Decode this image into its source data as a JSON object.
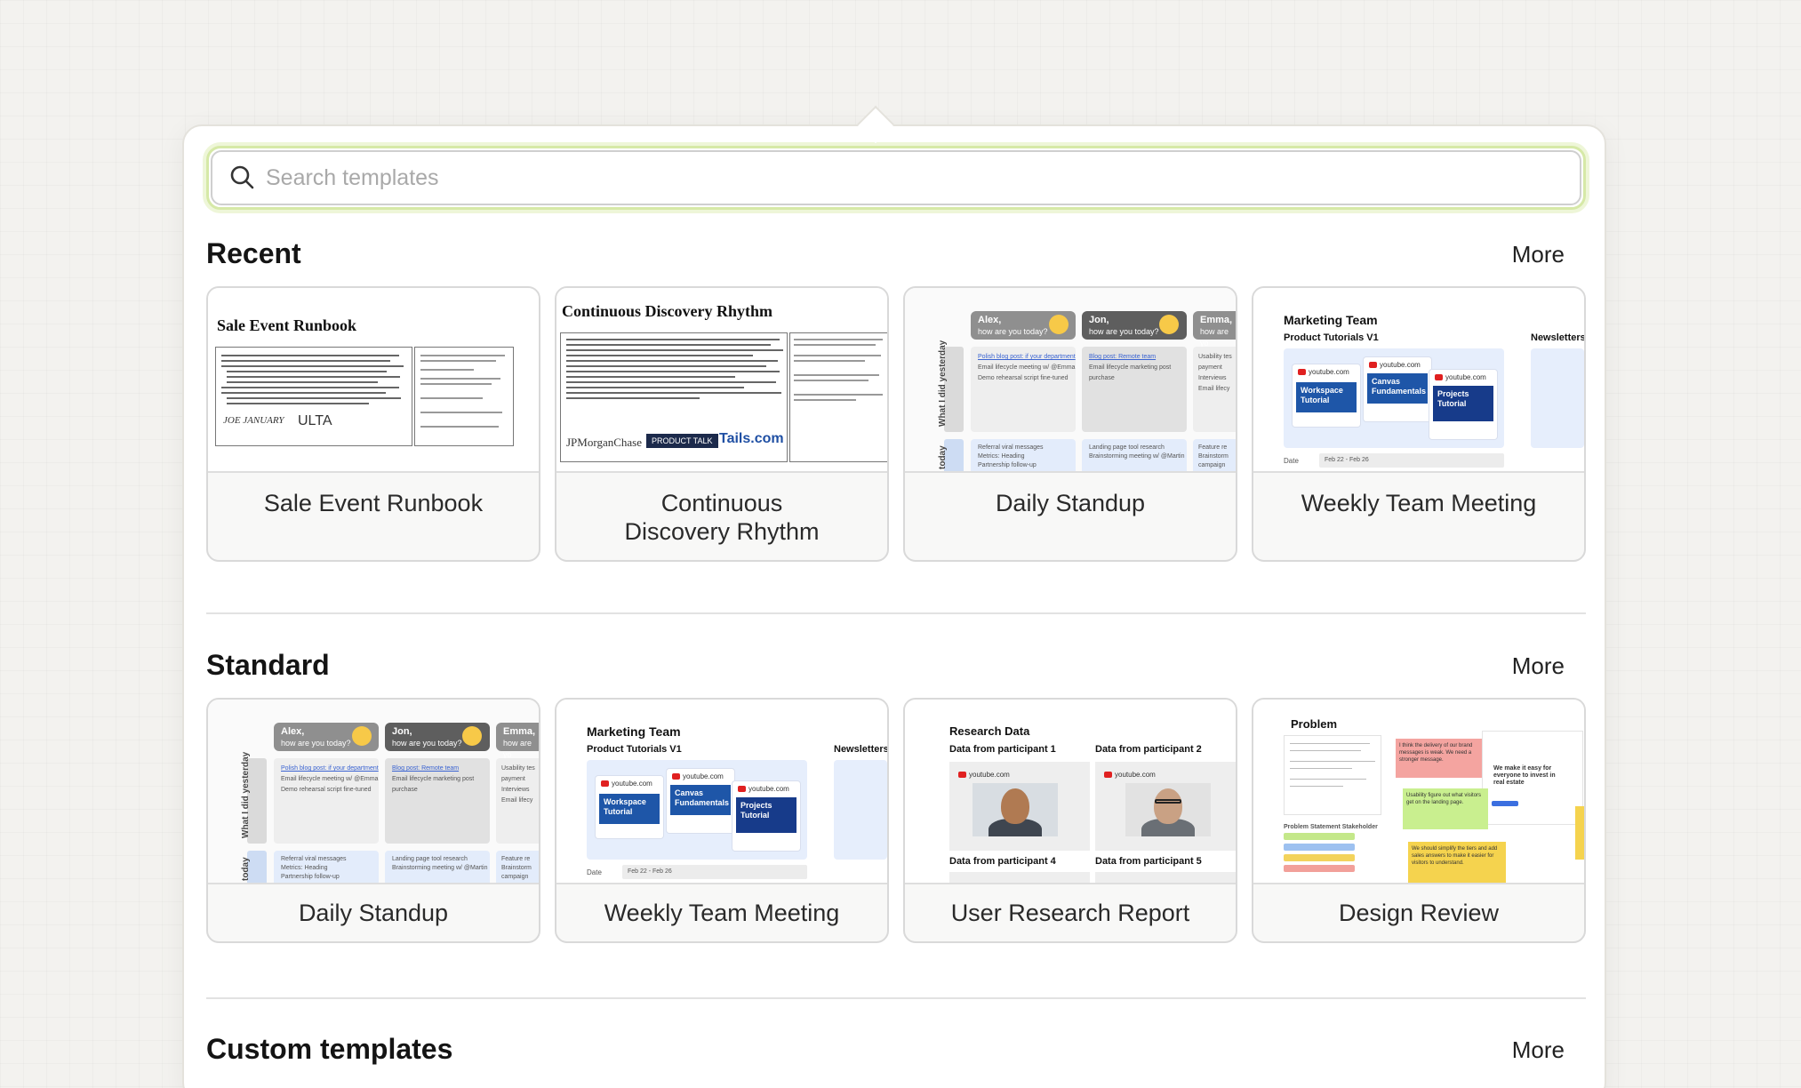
{
  "search": {
    "placeholder": "Search templates",
    "value": ""
  },
  "sections": {
    "recent": {
      "title": "Recent",
      "more": "More",
      "cards": [
        {
          "label": "Sale Event Runbook"
        },
        {
          "label": "Continuous\nDiscovery Rhythm"
        },
        {
          "label": "Daily Standup"
        },
        {
          "label": "Weekly Team Meeting"
        }
      ]
    },
    "standard": {
      "title": "Standard",
      "more": "More",
      "cards": [
        {
          "label": "Daily Standup"
        },
        {
          "label": "Weekly Team Meeting"
        },
        {
          "label": "User Research Report"
        },
        {
          "label": "Design Review"
        }
      ]
    },
    "custom": {
      "title": "Custom templates",
      "more": "More"
    }
  },
  "thumbs": {
    "runbook": {
      "title": "Sale Event Runbook",
      "logos": [
        "JOE JANUARY",
        "ULTA"
      ]
    },
    "discovery": {
      "title": "Continuous Discovery Rhythm",
      "logos": [
        "JPMorganChase",
        "PRODUCT TALK",
        "Tails.com"
      ]
    },
    "standup": {
      "people": [
        {
          "name": "Alex,",
          "sub": "how are you today?"
        },
        {
          "name": "Jon,",
          "sub": "how are you today?"
        },
        {
          "name": "Emma,",
          "sub": "how are yo"
        }
      ],
      "row1": "What I did yesterday",
      "row2": "today",
      "items_a": [
        "Polish blog post: if your department",
        "Email lifecycle meeting w/ @Emma",
        "Demo rehearsal script fine-tuned"
      ],
      "items_b": [
        "Blog post: Remote team",
        "Email lifecycle marketing post",
        "purchase"
      ],
      "items_c": [
        "Usability tes",
        "payment",
        "Interviews",
        "Email lifecy"
      ],
      "items_d": [
        "Referral viral messages",
        "Metrics: Heading",
        "Partnership follow-up"
      ],
      "items_e": [
        "Landing page tool research",
        "Brainstorming meeting w/ @Martin"
      ],
      "items_f": [
        "Feature re",
        "Brainstorm",
        "campaign"
      ]
    },
    "weekly": {
      "team": "Marketing Team",
      "sub": "Product Tutorials V1",
      "newsletters": "Newsletters",
      "yt": "youtube.com",
      "tiles": [
        "Workspace Tutorial",
        "Canvas Fundamentals",
        "Projects Tutorial"
      ],
      "date_label": "Date",
      "date_value": "Feb 22 - Feb 26"
    },
    "research": {
      "title": "Research Data",
      "p1": "Data from participant 1",
      "p2": "Data from participant 2",
      "p4": "Data from participant 4",
      "p5": "Data from participant 5",
      "yt": "youtube.com"
    },
    "design": {
      "title": "Problem",
      "notes": [
        "I think the delivery of our brand messages is weak. We need a stronger message.",
        "We make it easy for everyone to invest in real estate",
        "Usability figure out what visitors get on the landing page.",
        "We should simplify the tiers and add sales answers to make it easier for visitors to understand."
      ],
      "stack": "Problem Statement Stakeholder"
    }
  },
  "colors": {
    "accent_focus": "#d6e9a7",
    "panel_bg": "#ffffff",
    "page_bg": "#f3f2ef"
  }
}
